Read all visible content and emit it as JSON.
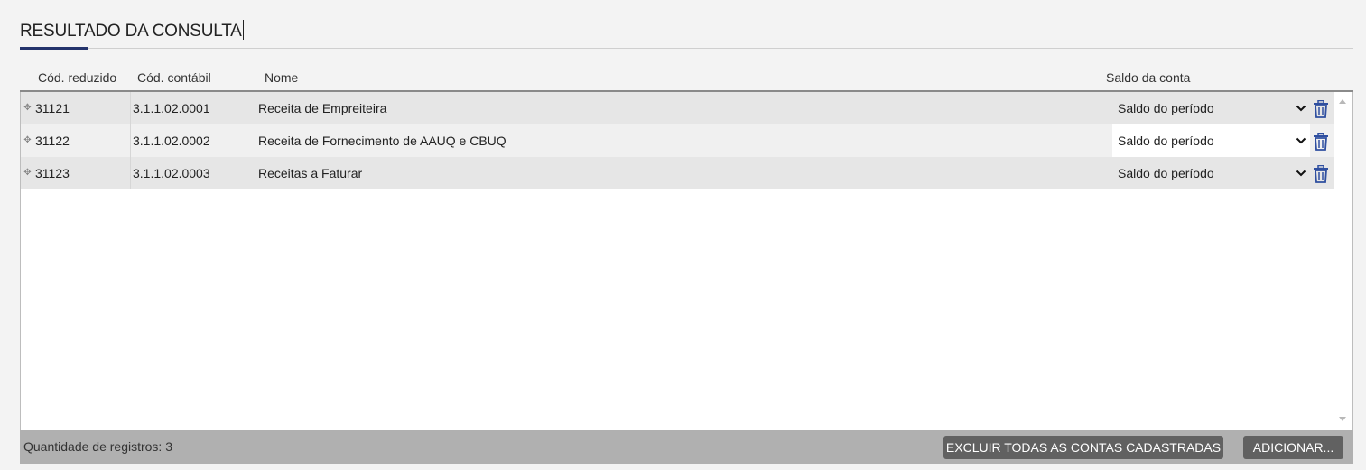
{
  "section": {
    "title": "RESULTADO DA CONSULTA"
  },
  "columns": {
    "cod_reduzido": "Cód. reduzido",
    "cod_contabil": "Cód. contábil",
    "nome": "Nome",
    "saldo": "Saldo da conta"
  },
  "rows": [
    {
      "drag_icon": "move-handle-icon",
      "cod_reduzido": "31121",
      "cod_contabil": "3.1.1.02.0001",
      "nome": "Receita de Empreiteira",
      "saldo": "Saldo do período"
    },
    {
      "drag_icon": "move-handle-icon",
      "cod_reduzido": "31122",
      "cod_contabil": "3.1.1.02.0002",
      "nome": "Receita de Fornecimento de AAUQ e CBUQ",
      "saldo": "Saldo do período"
    },
    {
      "drag_icon": "move-handle-icon",
      "cod_reduzido": "31123",
      "cod_contabil": "3.1.1.02.0003",
      "nome": "Receitas a Faturar",
      "saldo": "Saldo do período"
    }
  ],
  "footer": {
    "count_label": "Quantidade de registros:",
    "count_value": "3",
    "excluir_label": "EXCLUIR TODAS AS CONTAS CADASTRADAS",
    "adicionar_label": "ADICIONAR..."
  },
  "colors": {
    "accent": "#23336b",
    "trash_icon": "#2f4fa0",
    "button_bg": "#616161",
    "footer_bg": "#b0b0b0"
  }
}
